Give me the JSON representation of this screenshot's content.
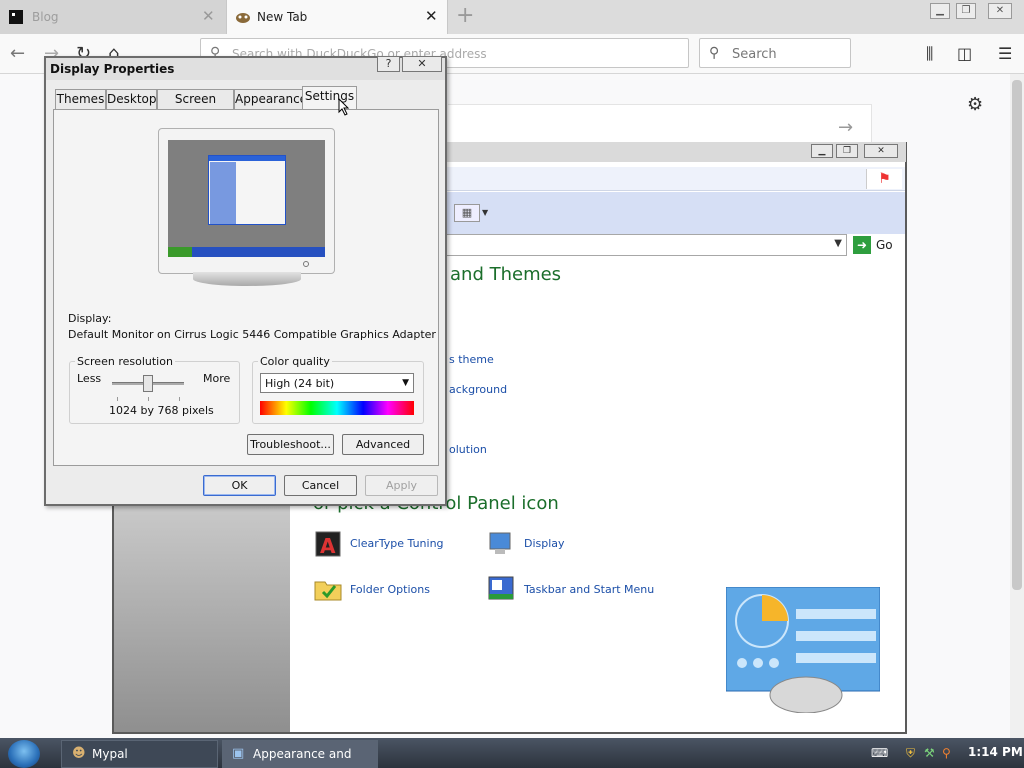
{
  "browser": {
    "tabs": [
      {
        "label": "Blog"
      },
      {
        "label": "New Tab"
      }
    ],
    "new_tab_glyph": "+",
    "urlbar_placeholder": "Search with DuckDuckGo or enter address",
    "search_placeholder": "Search",
    "icons": [
      "back-icon",
      "forward-icon",
      "reload-icon",
      "home-icon",
      "search-icon",
      "library-icon",
      "sidebar-icon",
      "menu-icon",
      "gear-icon"
    ]
  },
  "control_panel": {
    "go_label": "Go",
    "heading_top": "and Themes",
    "heading_bottom": "or pick a Control Panel icon",
    "task_links": [
      "s theme",
      "ackground",
      "olution"
    ],
    "icons": [
      {
        "label": "ClearType Tuning"
      },
      {
        "label": "Display"
      },
      {
        "label": "Folder Options"
      },
      {
        "label": "Taskbar and Start Menu"
      }
    ]
  },
  "dialog": {
    "title": "Display Properties",
    "tabs": [
      "Themes",
      "Desktop",
      "Screen Saver",
      "Appearance",
      "Settings"
    ],
    "active_tab": "Settings",
    "display_label": "Display:",
    "display_value": "Default Monitor on Cirrus Logic 5446 Compatible Graphics Adapter",
    "resolution": {
      "group_label": "Screen resolution",
      "less": "Less",
      "more": "More",
      "value": "1024 by 768 pixels",
      "slider_level": 0.5
    },
    "color_quality": {
      "group_label": "Color quality",
      "selected": "High (24 bit)"
    },
    "buttons": {
      "troubleshoot": "Troubleshoot...",
      "advanced": "Advanced",
      "ok": "OK",
      "cancel": "Cancel",
      "apply": "Apply"
    }
  },
  "taskbar": {
    "items": [
      {
        "label": "Mypal"
      },
      {
        "label": "Appearance and Th..."
      }
    ],
    "clock": "1:14 PM"
  },
  "colors": {
    "cp_heading": "#1b6e2b",
    "cp_link": "#1c4fa8",
    "taskbar": "#2c333d"
  }
}
